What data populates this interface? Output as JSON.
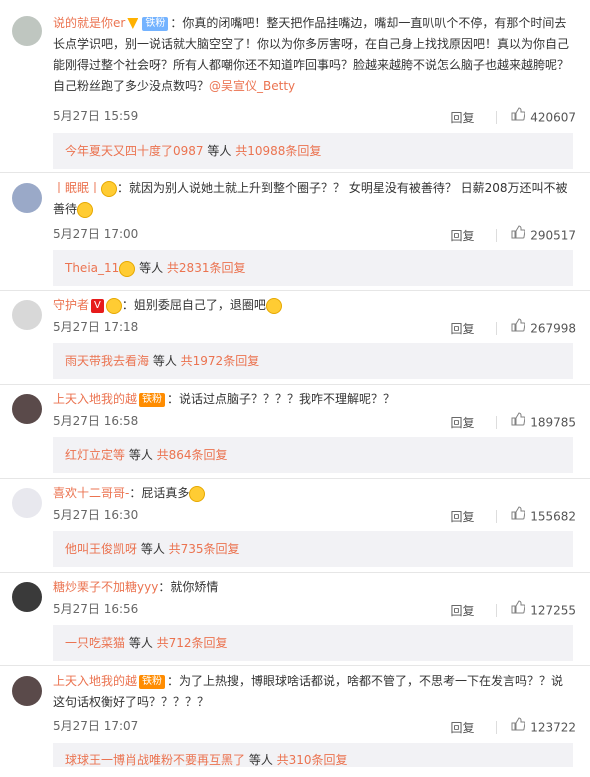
{
  "comments": [
    {
      "username": "说的就是你er",
      "badge": "铁粉",
      "text_lines": [
        "：你真的闭嘴吧！整天把作品挂嘴边，嘴却一直叭叭个不停，有那个时间去",
        "长点学识吧，别一说话就大脑空空了！你以为你多厉害呀，在自己身上找找原因吧！真以为你自己",
        "能刚得过整个社会呀？所有人都嘲你还不知道咋回事吗？脸越来越胯不说怎么脑子也越来越胯呢？",
        "自己粉丝跑了多少没点数吗？"
      ],
      "mention": "@吴宣仪_Betty",
      "time": "5月27日 15:59",
      "reply": "回复",
      "likes": "420607",
      "sub_user": "今年夏天又四十度了0987",
      "sub_and": " 等人 ",
      "sub_count": "共10988条回复"
    },
    {
      "username": "丨眠眠丨",
      "text_lines": [
        "：就因为别人说她土就上升到整个圈子？？ 女明星没有被善待？ 日薪208万还叫不被",
        "善待"
      ],
      "time": "5月27日 17:00",
      "reply": "回复",
      "likes": "290517",
      "sub_user": "Theia_11",
      "sub_and": " 等人 ",
      "sub_count": "共2831条回复"
    },
    {
      "username": "守护者",
      "text_lines": [
        "：姐别委屈自己了，退圈吧"
      ],
      "time": "5月27日 17:18",
      "reply": "回复",
      "likes": "267998",
      "sub_user": "雨天带我去看海",
      "sub_and": " 等人 ",
      "sub_count": "共1972条回复"
    },
    {
      "username": "上天入地我的越",
      "badge": "铁粉",
      "text_lines": [
        "：说话过点脑子？？？？我咋不理解呢？？"
      ],
      "time": "5月27日 16:58",
      "reply": "回复",
      "likes": "189785",
      "sub_user": "红灯立定等",
      "sub_and": " 等人 ",
      "sub_count": "共864条回复"
    },
    {
      "username": "喜欢十二哥哥-",
      "text_lines": [
        "：屁话真多"
      ],
      "time": "5月27日 16:30",
      "reply": "回复",
      "likes": "155682",
      "sub_user": "他叫王俊凯呀",
      "sub_and": " 等人 ",
      "sub_count": "共735条回复"
    },
    {
      "username": "糖炒栗子不加糖yyy",
      "text_lines": [
        "：就你矫情"
      ],
      "time": "5月27日 16:56",
      "reply": "回复",
      "likes": "127255",
      "sub_user": "一只吃菜猫",
      "sub_and": " 等人 ",
      "sub_count": "共712条回复"
    },
    {
      "username": "上天入地我的越",
      "badge": "铁粉",
      "text_lines": [
        "：为了上热搜，博眼球啥话都说，啥都不管了，不思考一下在发言吗？？说",
        "这句话权衡好了吗？？？？？"
      ],
      "time": "5月27日 17:07",
      "reply": "回复",
      "likes": "123722",
      "sub_user": "球球王一博肖战唯粉不要再互黑了",
      "sub_and": " 等人 ",
      "sub_count": "共310条回复"
    }
  ]
}
